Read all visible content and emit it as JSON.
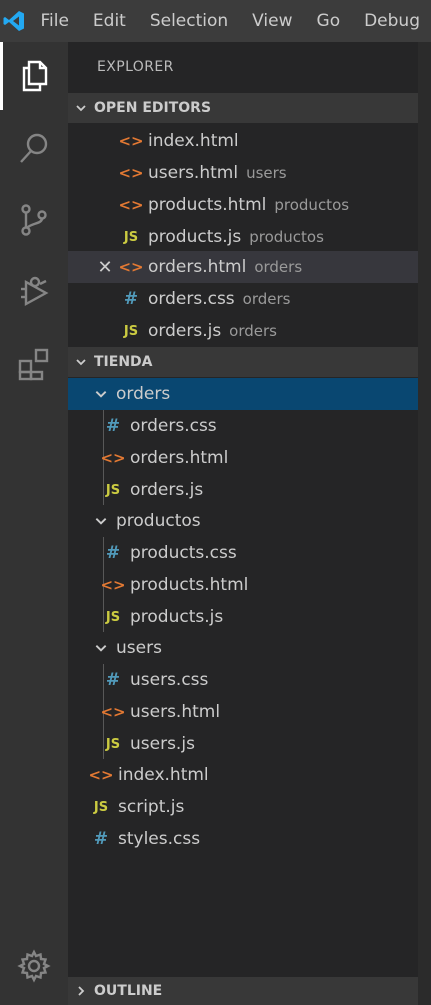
{
  "menubar": {
    "items": [
      "File",
      "Edit",
      "Selection",
      "View",
      "Go",
      "Debug"
    ]
  },
  "activity_bar": {
    "icons": [
      "explorer-icon",
      "search-icon",
      "source-control-icon",
      "debug-icon",
      "extensions-icon",
      "settings-gear-icon"
    ]
  },
  "explorer": {
    "title": "EXPLORER",
    "open_editors": {
      "header": "OPEN EDITORS",
      "items": [
        {
          "name": "index.html",
          "desc": "",
          "type": "html"
        },
        {
          "name": "users.html",
          "desc": "users",
          "type": "html"
        },
        {
          "name": "products.html",
          "desc": "productos",
          "type": "html"
        },
        {
          "name": "products.js",
          "desc": "productos",
          "type": "js"
        },
        {
          "name": "orders.html",
          "desc": "orders",
          "type": "html"
        },
        {
          "name": "orders.css",
          "desc": "orders",
          "type": "css"
        },
        {
          "name": "orders.js",
          "desc": "orders",
          "type": "js"
        }
      ]
    },
    "workspace": {
      "header": "TIENDA",
      "tree": [
        {
          "name": "orders",
          "kind": "folder"
        },
        {
          "name": "orders.css",
          "kind": "css"
        },
        {
          "name": "orders.html",
          "kind": "html"
        },
        {
          "name": "orders.js",
          "kind": "js"
        },
        {
          "name": "productos",
          "kind": "folder"
        },
        {
          "name": "products.css",
          "kind": "css"
        },
        {
          "name": "products.html",
          "kind": "html"
        },
        {
          "name": "products.js",
          "kind": "js"
        },
        {
          "name": "users",
          "kind": "folder"
        },
        {
          "name": "users.css",
          "kind": "css"
        },
        {
          "name": "users.html",
          "kind": "html"
        },
        {
          "name": "users.js",
          "kind": "js"
        },
        {
          "name": "index.html",
          "kind": "html"
        },
        {
          "name": "script.js",
          "kind": "js"
        },
        {
          "name": "styles.css",
          "kind": "css"
        }
      ]
    },
    "outline_header": "OUTLINE"
  },
  "icon_glyphs": {
    "html": "<>",
    "css": "#",
    "js": "JS"
  },
  "colors": {
    "html_icon": "#e37933",
    "css_icon": "#519aba",
    "js_icon": "#cbcb41",
    "selected_row": "#094771",
    "vscode_blue": "#23a9f2"
  }
}
